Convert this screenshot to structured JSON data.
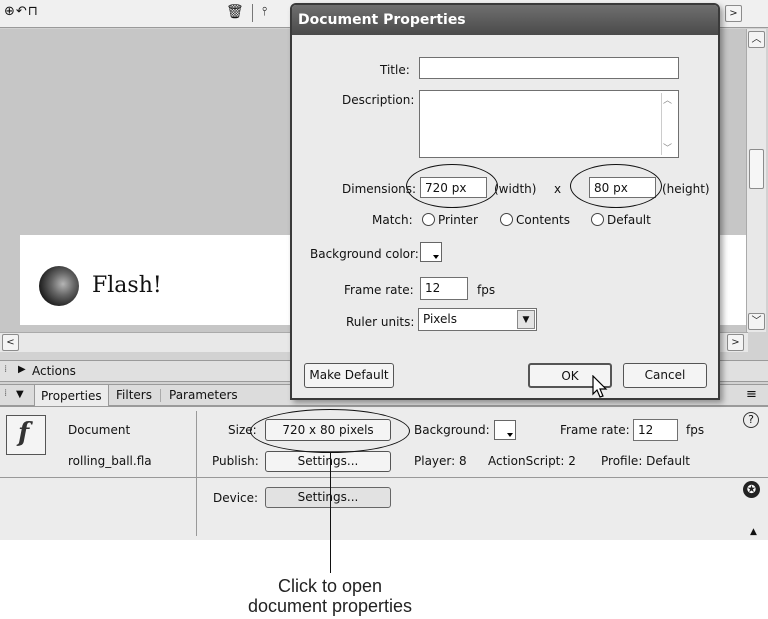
{
  "dialog": {
    "title": "Document Properties",
    "title_label": "Title:",
    "title_value": "",
    "description_label": "Description:",
    "description_value": "",
    "dimensions_label": "Dimensions:",
    "width_value": "720 px",
    "width_unit": "(width)",
    "x_sep": "x",
    "height_value": "80 px",
    "height_unit": "(height)",
    "match_label": "Match:",
    "match_options": [
      "Printer",
      "Contents",
      "Default"
    ],
    "bg_color_label": "Background color:",
    "frame_rate_label": "Frame rate:",
    "frame_rate_value": "12",
    "fps_label": "fps",
    "ruler_label": "Ruler units:",
    "ruler_value": "Pixels",
    "make_default": "Make Default",
    "ok": "OK",
    "cancel": "Cancel"
  },
  "stage": {
    "text": "Flash!"
  },
  "panels": {
    "actions": "Actions",
    "tabs": [
      "Properties",
      "Filters",
      "Parameters"
    ]
  },
  "properties": {
    "doc_label": "Document",
    "file_name": "rolling_ball.fla",
    "size_label": "Size:",
    "size_value": "720 x 80 pixels",
    "background_label": "Background:",
    "frame_rate_label": "Frame rate:",
    "frame_rate_value": "12",
    "fps_label": "fps",
    "publish_label": "Publish:",
    "publish_settings": "Settings...",
    "player": "Player: 8",
    "actionscript": "ActionScript:  2",
    "profile": "Profile:  Default",
    "device_label": "Device:",
    "device_settings": "Settings...",
    "logo_glyph": "f"
  },
  "callout": {
    "line1": "Click to open",
    "line2": "document properties"
  },
  "icons": {
    "help": "?",
    "accessibility": "✪",
    "menu": "≡"
  }
}
